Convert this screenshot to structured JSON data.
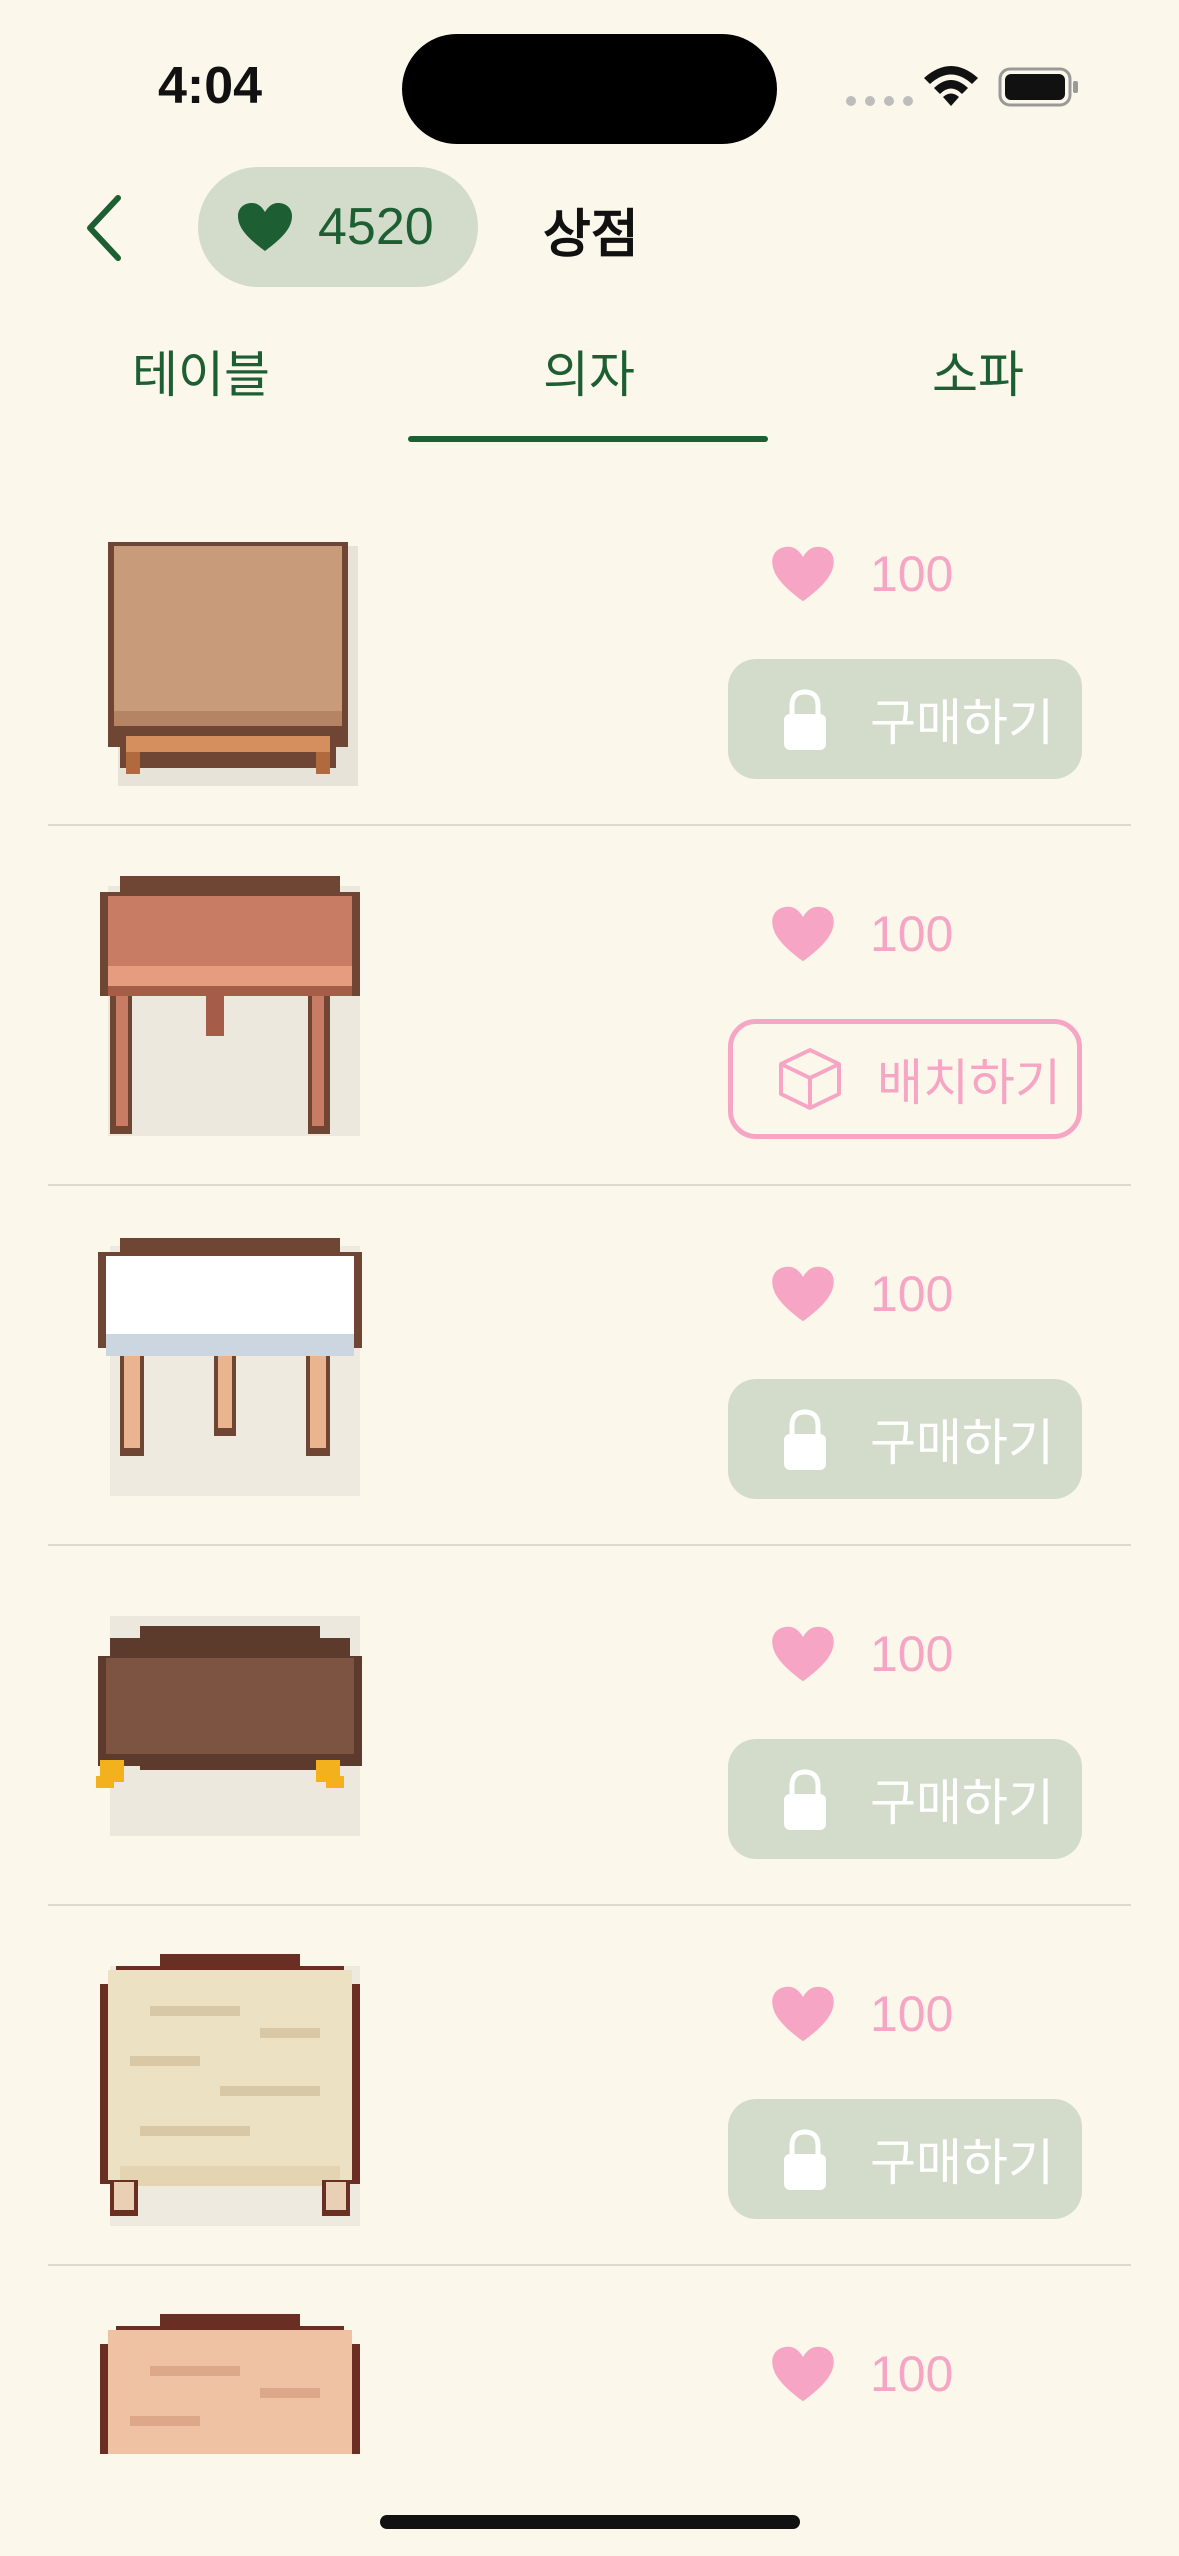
{
  "status_bar": {
    "time": "4:04"
  },
  "header": {
    "coins": "4520",
    "title": "상점"
  },
  "tabs": [
    {
      "label": "테이블",
      "selected": false
    },
    {
      "label": "의자",
      "selected": true
    },
    {
      "label": "소파",
      "selected": false
    }
  ],
  "items": [
    {
      "price": "100",
      "action_label": "구매하기",
      "locked": true
    },
    {
      "price": "100",
      "action_label": "배치하기",
      "locked": false
    },
    {
      "price": "100",
      "action_label": "구매하기",
      "locked": true
    },
    {
      "price": "100",
      "action_label": "구매하기",
      "locked": true
    },
    {
      "price": "100",
      "action_label": "구매하기",
      "locked": true
    },
    {
      "price": "100"
    }
  ],
  "colors": {
    "background": "#FBF7EB",
    "accent_green": "#1D5E33",
    "pill_green": "#D3DCCB",
    "pink": "#F6A6C4"
  },
  "icons": {
    "back": "chevron-left-icon",
    "coin": "heart-icon",
    "price": "heart-icon",
    "locked": "lock-icon",
    "place": "cube-icon"
  }
}
